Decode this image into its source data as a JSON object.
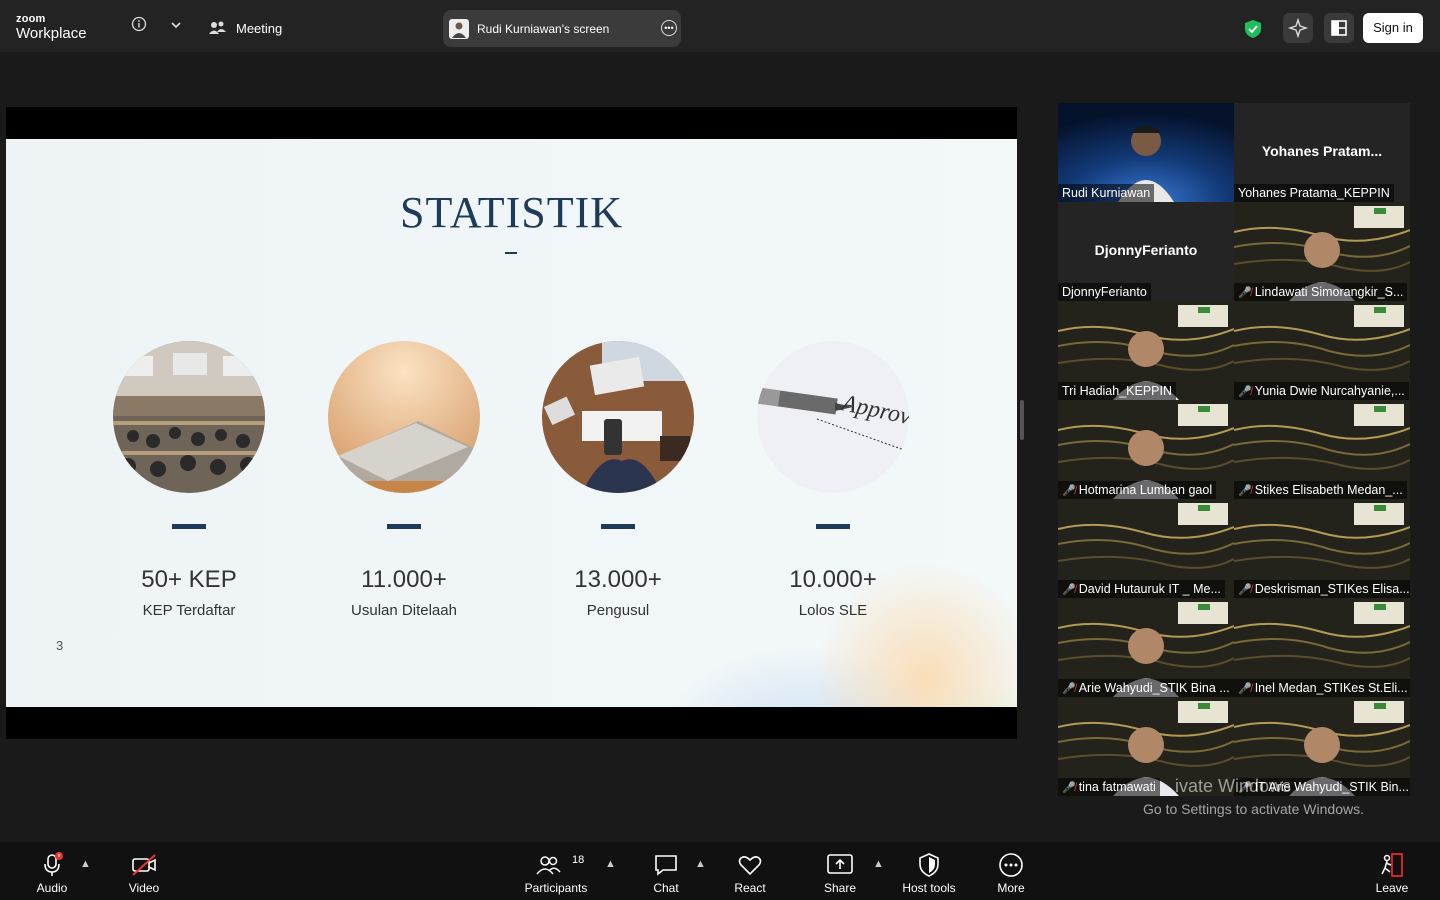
{
  "app": {
    "logo_top": "zoom",
    "logo_bottom": "Workplace",
    "meeting_label": "Meeting",
    "sign_in": "Sign in"
  },
  "share": {
    "label": "Rudi Kurniawan's screen"
  },
  "slide": {
    "title": "STATISTIK",
    "page": "3",
    "stats": [
      {
        "value": "50+ KEP",
        "label": "KEP Terdaftar"
      },
      {
        "value": "11.000+",
        "label": "Usulan Ditelaah"
      },
      {
        "value": "13.000+",
        "label": "Pengusul"
      },
      {
        "value": "10.000+",
        "label": "Lolos SLE"
      }
    ],
    "pen_text": "Approv"
  },
  "participants": [
    {
      "name": "Rudi Kurniawan",
      "muted": false,
      "active": true
    },
    {
      "name": "Yohanes Pratama_KEPPIN",
      "display": "Yohanes  Pratam...",
      "muted": false
    },
    {
      "name": "DjonnyFerianto",
      "display": "DjonnyFerianto",
      "muted": false
    },
    {
      "name": "Lindawati Simorangkir_S...",
      "muted": true
    },
    {
      "name": "Tri Hadiah_KEPPIN",
      "muted": false
    },
    {
      "name": "Yunia Dwie Nurcahyanie,...",
      "muted": true
    },
    {
      "name": "Hotmarina Lumban gaol",
      "muted": true
    },
    {
      "name": "Stikes Elisabeth Medan_...",
      "muted": true
    },
    {
      "name": "David Hutauruk IT _ Me...",
      "muted": true
    },
    {
      "name": "Deskrisman_STIKes Elisa...",
      "muted": true
    },
    {
      "name": "Arie Wahyudi_STIK Bina ...",
      "muted": true
    },
    {
      "name": "Inel Medan_STIKes St.Eli...",
      "muted": true
    },
    {
      "name": "tina fatmawati",
      "muted": true
    },
    {
      "name": "IT Arie Wahyudi_STIK Bin...",
      "muted": true
    }
  ],
  "watermark": {
    "line1": "ivate Windows",
    "line2": "Go to Settings to activate Windows."
  },
  "toolbar": {
    "audio": "Audio",
    "video": "Video",
    "participants": "Participants",
    "participants_count": "18",
    "chat": "Chat",
    "react": "React",
    "share": "Share",
    "host_tools": "Host tools",
    "more": "More",
    "leave": "Leave"
  },
  "colors": {
    "accent_green": "#2ecc71",
    "mute_red": "#e33333",
    "slide_navy": "#1d3a5a",
    "leave_red": "#e02828"
  }
}
